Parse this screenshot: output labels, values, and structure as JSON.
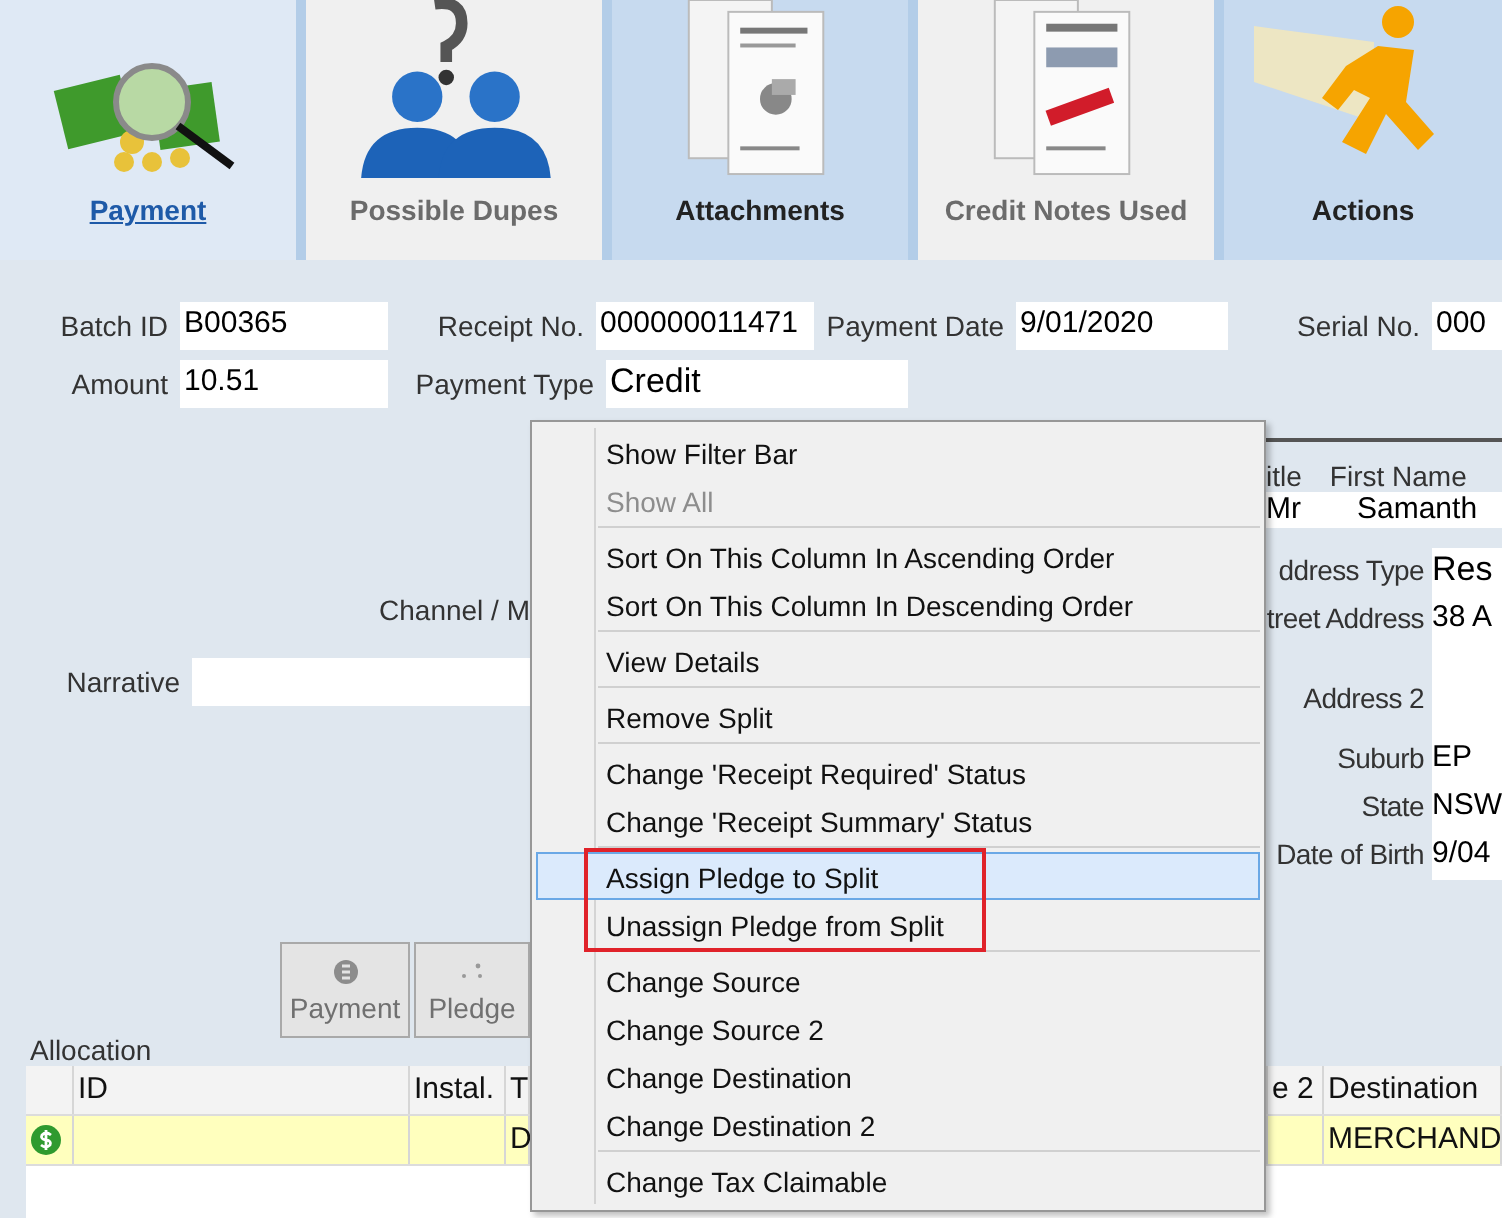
{
  "tabs": [
    {
      "kind": "money",
      "label": "Payment",
      "selected": true,
      "disabled": false
    },
    {
      "kind": "people",
      "label": "Possible Dupes",
      "selected": false,
      "disabled": true
    },
    {
      "kind": "attachment",
      "label": "Attachments",
      "selected": false,
      "disabled": false
    },
    {
      "kind": "credit",
      "label": "Credit Notes Used",
      "selected": false,
      "disabled": true
    },
    {
      "kind": "runner",
      "label": "Actions",
      "selected": false,
      "disabled": false
    }
  ],
  "header_fields": [
    [
      {
        "label": "Batch ID",
        "value": "B00365"
      },
      {
        "label": "Receipt No.",
        "value": "000000011471"
      },
      {
        "label": "Payment Date",
        "value": "9/01/2020"
      },
      {
        "label": "Serial No.",
        "value": "000"
      }
    ],
    [
      {
        "label": "Amount",
        "value": "10.51"
      },
      {
        "label": "Payment Type",
        "value": "Credit"
      }
    ]
  ],
  "channel_label": "Channel / M",
  "narrative_label": "Narrative",
  "contact": {
    "title_label": "itle",
    "first_name_label": "First Name",
    "title": "Mr",
    "first_name": "Samanth",
    "address_fields": [
      {
        "label": "ddress Type",
        "value": "Res"
      },
      {
        "label": "treet Address",
        "value": "38 A"
      },
      {
        "label": "Address 2"
      },
      {
        "label": "Suburb",
        "value": "EP"
      },
      {
        "label": "State",
        "value": "NSW"
      },
      {
        "label": "Date of Birth",
        "value": "9/04"
      }
    ]
  },
  "action_buttons": [
    {
      "kind": "payment",
      "label": "Payment"
    },
    {
      "kind": "pledge",
      "label": "Pledge"
    }
  ],
  "allocation": {
    "title": "Allocation",
    "columns": [
      "ID",
      "Instal.",
      "T",
      "e 2",
      "Destination"
    ],
    "rows": [
      {
        "column_3": "D",
        "destination": "MERCHAND",
        "selected": true
      }
    ]
  },
  "context_menu": {
    "groups": [
      {
        "outlined": false,
        "items": [
          {
            "label": "Show Filter Bar",
            "disabled": false,
            "highlighted": false
          },
          {
            "label": "Show All",
            "disabled": true,
            "highlighted": false
          }
        ]
      },
      {
        "outlined": false,
        "items": [
          {
            "label": "Sort On This Column In Ascending Order",
            "disabled": false,
            "highlighted": false
          },
          {
            "label": "Sort On This Column In Descending Order",
            "disabled": false,
            "highlighted": false
          }
        ]
      },
      {
        "outlined": false,
        "items": [
          {
            "label": "View Details",
            "disabled": false,
            "highlighted": false
          }
        ]
      },
      {
        "outlined": false,
        "items": [
          {
            "label": "Remove Split",
            "disabled": false,
            "highlighted": false
          }
        ]
      },
      {
        "outlined": false,
        "items": [
          {
            "label": "Change 'Receipt Required' Status",
            "disabled": false,
            "highlighted": false
          },
          {
            "label": "Change 'Receipt Summary' Status",
            "disabled": false,
            "highlighted": false
          }
        ]
      },
      {
        "outlined": true,
        "items": [
          {
            "label": "Assign Pledge to Split",
            "disabled": false,
            "highlighted": true
          },
          {
            "label": "Unassign Pledge from Split",
            "disabled": false,
            "highlighted": false
          }
        ]
      },
      {
        "outlined": false,
        "items": [
          {
            "label": "Change Source",
            "disabled": false,
            "highlighted": false
          },
          {
            "label": "Change Source 2",
            "disabled": false,
            "highlighted": false
          },
          {
            "label": "Change Destination",
            "disabled": false,
            "highlighted": false
          },
          {
            "label": "Change Destination 2",
            "disabled": false,
            "highlighted": false
          }
        ]
      },
      {
        "outlined": false,
        "items": [
          {
            "label": "Change Tax Claimable",
            "disabled": false,
            "highlighted": false
          }
        ]
      }
    ]
  }
}
